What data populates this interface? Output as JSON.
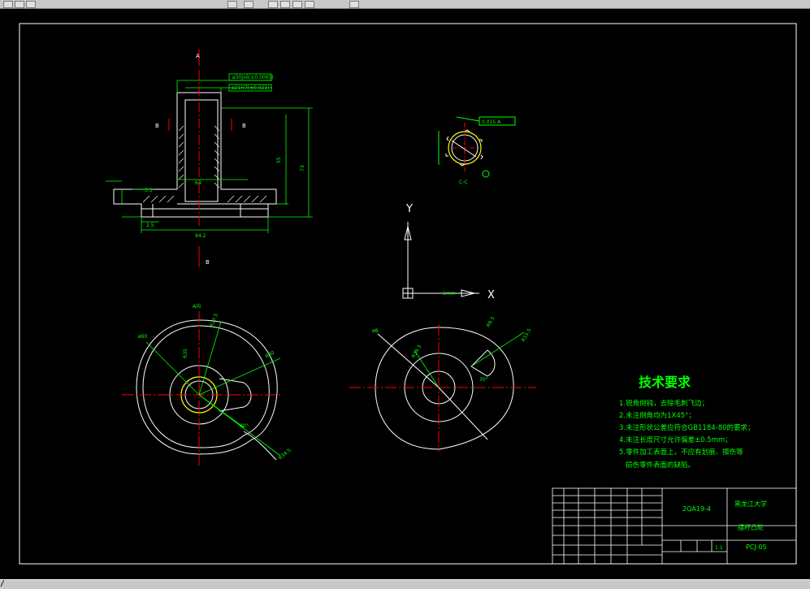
{
  "toolbar": {
    "buttons": [
      "btn",
      "btn",
      "btn",
      "btn",
      "btn",
      "btn",
      "btn",
      "btn",
      "btn",
      "btn"
    ]
  },
  "status": {
    "prompt": "/"
  },
  "drawing": {
    "tech_title": "技术要求",
    "tech_lines": [
      "1.锐角倒钝，去除毛刺飞边；",
      "2.未注倒角均为1X45°；",
      "3.未注形状公差应符合GB1184-80的要求；",
      "4.未注长度尺寸允许偏差±0.5mm；",
      "5.零件加工表面上，不应有划痕、擦伤等",
      "损伤零件表面的缺陷。"
    ],
    "ucs": {
      "x": "X",
      "y": "Y"
    },
    "section_labels": {
      "a": "A",
      "b": "B",
      "c": "C-C",
      "view_a": "A向"
    },
    "title_block": {
      "part_no": "2QA19-4",
      "school": "黑龙江大学",
      "part_name": "摆杆凸轮",
      "drawing_no": "PCJ-05",
      "scale": "1:1"
    }
  }
}
